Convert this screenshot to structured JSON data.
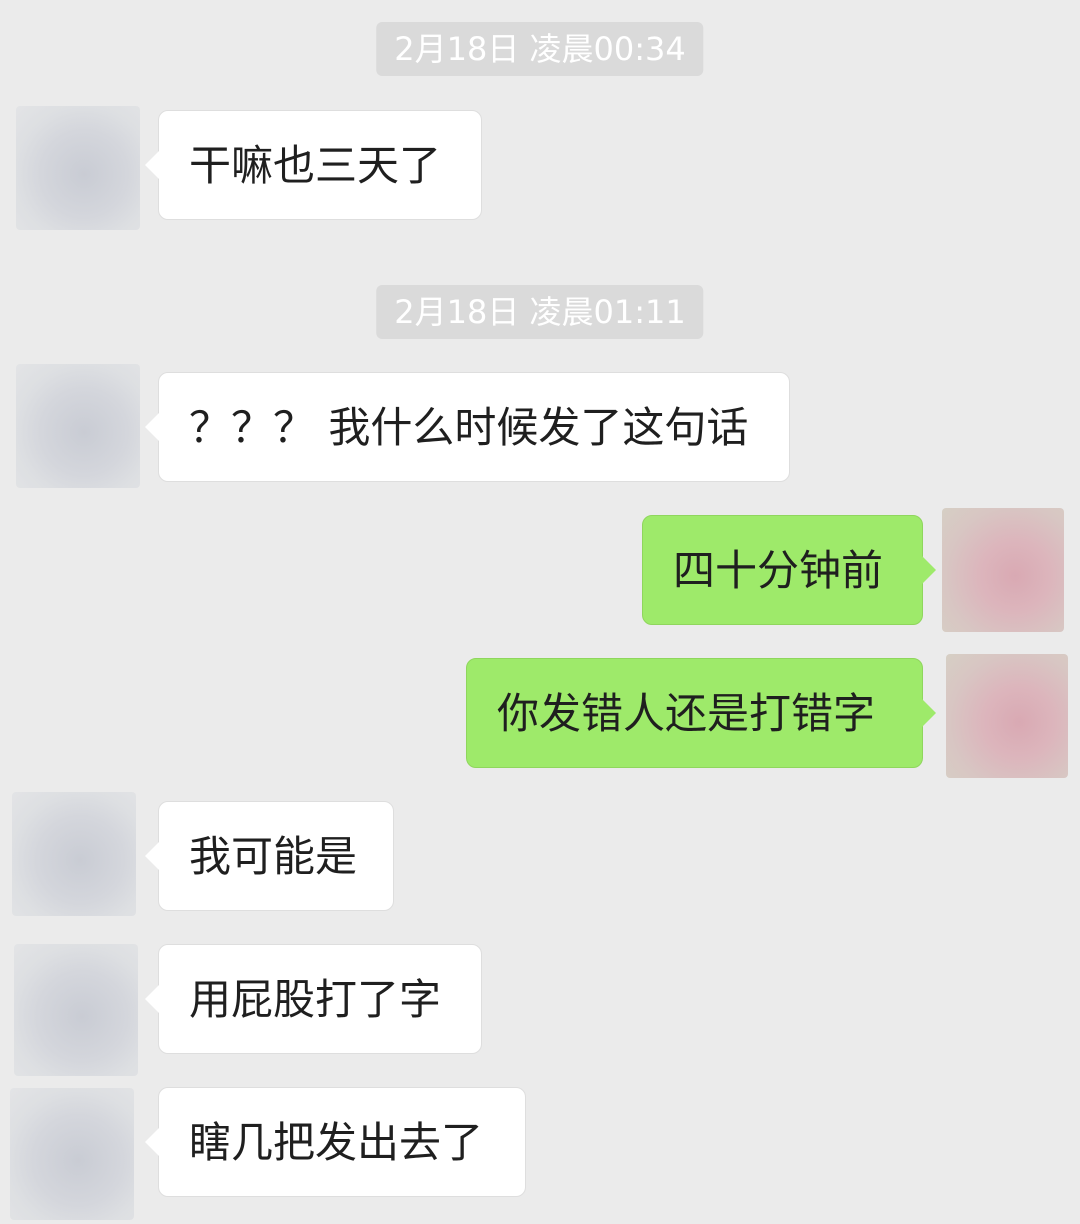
{
  "timestamps": [
    "2月18日 凌晨00:34",
    "2月18日 凌晨01:11"
  ],
  "messages": [
    {
      "sender": "other",
      "text": "干嘛也三天了"
    },
    {
      "sender": "other",
      "text": "？？？ 我什么时候发了这句话"
    },
    {
      "sender": "me",
      "text": "四十分钟前"
    },
    {
      "sender": "me",
      "text": "你发错人还是打错字"
    },
    {
      "sender": "other",
      "text": "我可能是"
    },
    {
      "sender": "other",
      "text": "用屁股打了字"
    },
    {
      "sender": "other",
      "text": "瞎几把发出去了"
    }
  ],
  "colors": {
    "background": "#ebebeb",
    "timestamp_bg": "#dadada",
    "incoming_bubble": "#ffffff",
    "outgoing_bubble": "#9eea6a"
  }
}
